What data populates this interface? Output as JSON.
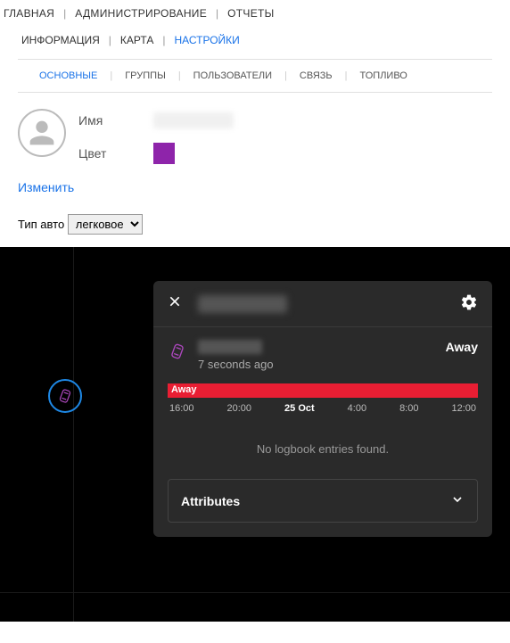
{
  "topnav": {
    "items": [
      "ГЛАВНАЯ",
      "АДМИНИСТРИРОВАНИЕ",
      "ОТЧЕТЫ"
    ]
  },
  "subnav": {
    "items": [
      "ИНФОРМАЦИЯ",
      "КАРТА",
      "НАСТРОЙКИ"
    ],
    "active_index": 2
  },
  "tabs": {
    "items": [
      "ОСНОВНЫЕ",
      "ГРУППЫ",
      "ПОЛЬЗОВАТЕЛИ",
      "СВЯЗЬ",
      "ТОПЛИВО"
    ],
    "active_index": 0
  },
  "form": {
    "name_label": "Имя",
    "color_label": "Цвет",
    "color_value": "#8e24aa",
    "edit_link": "Изменить"
  },
  "cartype": {
    "label": "Тип авто",
    "selected": "легковое"
  },
  "panel": {
    "vehicle_time": "7 seconds ago",
    "vehicle_status": "Away",
    "timeline": {
      "bar_label": "Away",
      "bar_color": "#e91e33",
      "ticks": [
        "16:00",
        "20:00",
        "25 Oct",
        "4:00",
        "8:00",
        "12:00"
      ],
      "bold_index": 2
    },
    "no_entries": "No logbook entries found.",
    "attributes_label": "Attributes"
  }
}
